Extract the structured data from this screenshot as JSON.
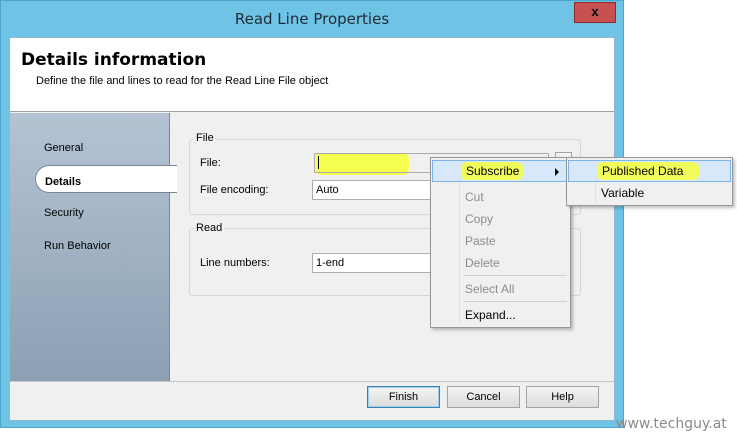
{
  "window": {
    "title": "Read Line Properties",
    "close_label": "x"
  },
  "header": {
    "title": "Details information",
    "subtitle": "Define the file and lines to read for the Read Line File object"
  },
  "sidebar": {
    "items": [
      {
        "label": "General"
      },
      {
        "label": "Details"
      },
      {
        "label": "Security"
      },
      {
        "label": "Run Behavior"
      }
    ]
  },
  "file_group": {
    "label": "File",
    "file_label": "File:",
    "file_value": "",
    "encoding_label": "File encoding:",
    "encoding_value": "Auto"
  },
  "read_group": {
    "label": "Read",
    "line_numbers_label": "Line numbers:",
    "line_numbers_value": "1-end"
  },
  "buttons": {
    "finish": "Finish",
    "cancel": "Cancel",
    "help": "Help"
  },
  "context_menu": {
    "items": [
      {
        "label": "Subscribe"
      },
      {
        "label": "Cut"
      },
      {
        "label": "Copy"
      },
      {
        "label": "Paste"
      },
      {
        "label": "Delete"
      },
      {
        "label": "Select All"
      },
      {
        "label": "Expand..."
      }
    ]
  },
  "submenu": {
    "items": [
      {
        "label": "Published Data"
      },
      {
        "label": "Variable"
      }
    ]
  },
  "watermark": "www.techguy.at",
  "colors": {
    "highlight": "#f6ff3d",
    "title_bar": "#6fc4e6",
    "menu_selection": "#d6e8fa"
  }
}
